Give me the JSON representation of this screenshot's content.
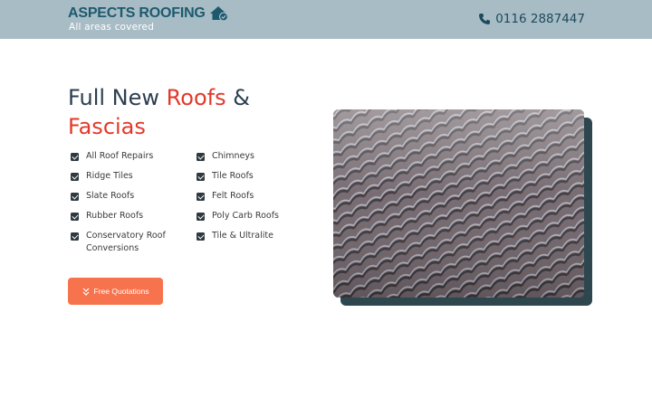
{
  "header": {
    "logo_text": "ASPECTS ROOFING",
    "logo_icon": "house-check-icon",
    "tagline": "All areas covered",
    "phone_icon": "phone-icon",
    "phone": "0116 2887447"
  },
  "hero": {
    "headline_part1": "Full New ",
    "headline_accent1": "Roofs",
    "headline_part2": " & ",
    "headline_accent2": "Fascias",
    "features": [
      "All Roof Repairs",
      "Chimneys",
      "Ridge Tiles",
      "Tile Roofs",
      "Slate Roofs",
      "Felt Roofs",
      "Rubber Roofs",
      "Poly Carb Roofs",
      "Conservatory Roof Conversions",
      "Tile & Ultralite"
    ],
    "cta_label": "Free Quotations",
    "cta_icon": "double-chevron-down-icon",
    "image": "roof-tiles-photo"
  },
  "colors": {
    "topbar": "#a8bcc6",
    "brand": "#1d5a6e",
    "accent": "#e2392a",
    "cta": "#f7734e",
    "photo_shadow": "#2e474e"
  }
}
